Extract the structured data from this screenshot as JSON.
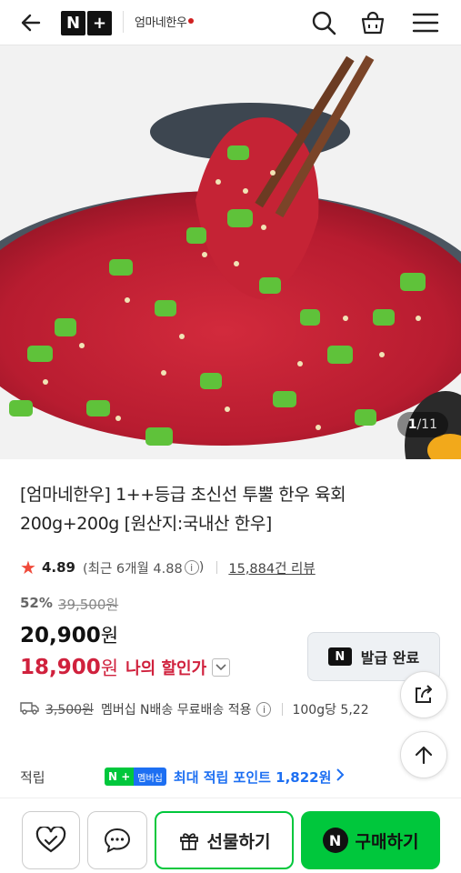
{
  "header": {
    "nplus_left": "N",
    "nplus_right": "+",
    "brand": "엄마네한우"
  },
  "hero": {
    "current": "1",
    "total": "/11"
  },
  "product": {
    "title": "[엄마네한우] 1++등급 초신선 투뿔 한우 육회 200g+200g [원산지:국내산 한우]",
    "rating": "4.89",
    "recent": "(최근 6개월 4.88",
    "info": "i",
    "recent_close": ")",
    "reviews": "15,884건 리뷰",
    "discount_rate": "52%",
    "original_price": "39,500원",
    "price": "20,900",
    "price_unit": "원",
    "my_price": "18,900",
    "my_price_unit": "원",
    "my_price_label": "나의 할인가"
  },
  "coupon": {
    "badge": "N",
    "label": "발급 완료"
  },
  "shipping": {
    "original_fee": "3,500원",
    "text": "멤버십 N배송 무료배송 적용",
    "info": "i",
    "unit_price": "100g당 5,22"
  },
  "points": {
    "label": "적립",
    "badge_n": "N +",
    "badge_member": "멤버십",
    "text": "최대 적립 포인트 1,822원"
  },
  "bottom": {
    "gift_label": "선물하기",
    "buy_badge": "N",
    "buy_label": "구매하기"
  },
  "colors": {
    "naver_green": "#00c73c",
    "discount_red": "#d0213d",
    "point_blue": "#1d6ff2"
  }
}
